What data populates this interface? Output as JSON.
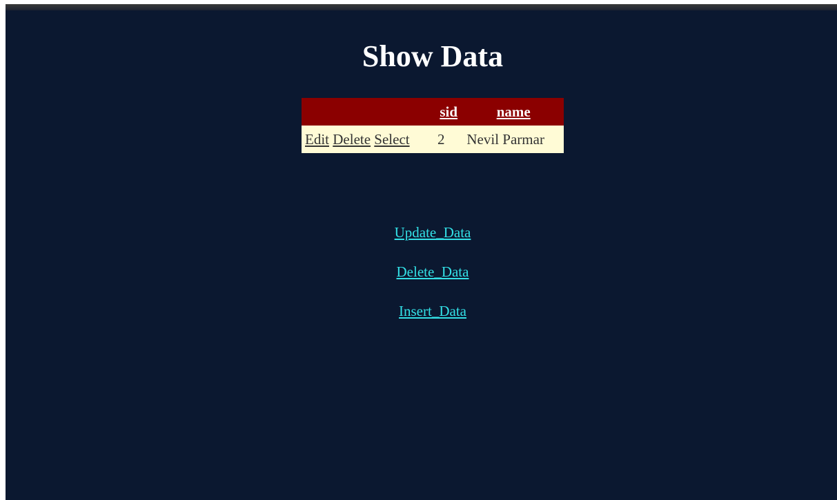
{
  "page": {
    "title": "Show Data"
  },
  "grid": {
    "columns": [
      "",
      "sid",
      "name"
    ],
    "rows": [
      {
        "actions": [
          "Edit",
          "Delete",
          "Select"
        ],
        "sid": "2",
        "name": "Nevil Parmar"
      }
    ]
  },
  "links": {
    "update": "Update_Data",
    "delete": "Delete_Data",
    "insert": "Insert_Data"
  },
  "colors": {
    "background": "#0b1830",
    "header": "#8b0000",
    "row": "#fffbd6",
    "link": "#33e0e6"
  }
}
